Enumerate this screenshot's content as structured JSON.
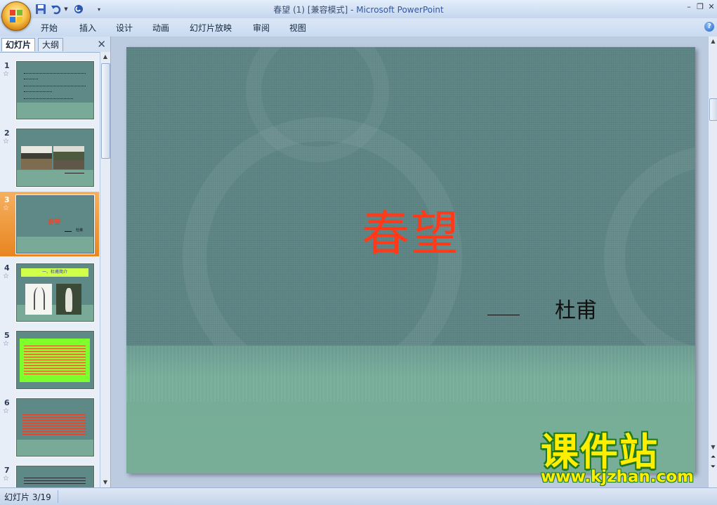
{
  "window": {
    "title_doc": "春望 (1) [兼容模式]",
    "title_sep": " - ",
    "title_app": "Microsoft PowerPoint",
    "minimize": "–",
    "restore": "❐",
    "close": "✕"
  },
  "ribbon": {
    "tabs": [
      "开始",
      "插入",
      "设计",
      "动画",
      "幻灯片放映",
      "审阅",
      "视图"
    ],
    "help": "?"
  },
  "left_pane": {
    "tab_slides": "幻灯片",
    "tab_outline": "大纲",
    "close": "✕",
    "active_slide": 3,
    "slides": [
      {
        "number": "1"
      },
      {
        "number": "2"
      },
      {
        "number": "3",
        "title": "春望",
        "author": "杜甫"
      },
      {
        "number": "4",
        "header": "一、杜甫简介"
      },
      {
        "number": "5"
      },
      {
        "number": "6"
      },
      {
        "number": "7"
      }
    ]
  },
  "slide": {
    "title": "春望",
    "author": "杜甫"
  },
  "watermark": {
    "logo": "课件站",
    "url": "www.kjzhan.com"
  },
  "status": {
    "slide_counter": "幻灯片 3/19"
  },
  "colors": {
    "slide_bg": "#5d8484",
    "slide_title": "#ff3a1a",
    "active_thumb": "#e88520",
    "thumb5_bg": "#7cff2a"
  }
}
